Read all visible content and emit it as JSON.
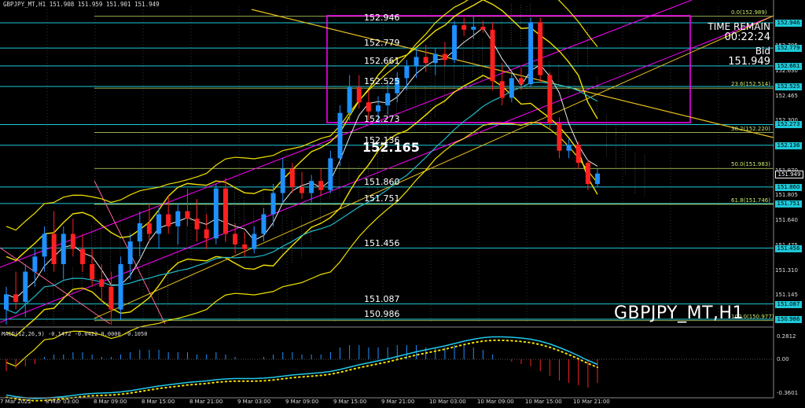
{
  "header": {
    "info": "GBPJPY_MT,H1  151.908 151.959 151.901 151.949",
    "macd_label": "MACD(12,26,9) -0.1472 -0.0422 0.0000 -0.1050"
  },
  "symbol_label": "GBPJPY_MT,H1",
  "timer": {
    "title": "TIME REMAIN",
    "value": "00:22:24",
    "bid_label": "Bid",
    "bid_value": "151.949"
  },
  "levels": [
    {
      "label": "152.946",
      "price": 152.946
    },
    {
      "label": "152.779",
      "price": 152.779
    },
    {
      "label": "152.661",
      "price": 152.661
    },
    {
      "label": "152.525",
      "price": 152.525
    },
    {
      "label": "152.273",
      "price": 152.273
    },
    {
      "label": "152.136",
      "price": 152.136
    },
    {
      "label": "151.860",
      "price": 151.86
    },
    {
      "label": "151.751",
      "price": 151.751
    },
    {
      "label": "151.456",
      "price": 151.456
    },
    {
      "label": "151.087",
      "price": 151.087
    },
    {
      "label": "150.986",
      "price": 150.986
    }
  ],
  "big_price": "152.165",
  "axis_ticks": [
    "152.795",
    "152.630",
    "152.465",
    "152.300",
    "151.970",
    "151.805",
    "151.640",
    "151.475",
    "151.310",
    "151.145"
  ],
  "right_tags": [
    {
      "label": "152.946",
      "price": 152.946,
      "kind": "level"
    },
    {
      "label": "152.779",
      "price": 152.779,
      "kind": "level"
    },
    {
      "label": "152.661",
      "price": 152.661,
      "kind": "level"
    },
    {
      "label": "152.525",
      "price": 152.525,
      "kind": "level"
    },
    {
      "label": "152.273",
      "price": 152.273,
      "kind": "level"
    },
    {
      "label": "152.136",
      "price": 152.136,
      "kind": "level"
    },
    {
      "label": "151.949",
      "price": 151.949,
      "kind": "current"
    },
    {
      "label": "151.860",
      "price": 151.86,
      "kind": "level"
    },
    {
      "label": "151.751",
      "price": 151.751,
      "kind": "level"
    },
    {
      "label": "151.456",
      "price": 151.456,
      "kind": "level"
    },
    {
      "label": "151.087",
      "price": 151.087,
      "kind": "level"
    },
    {
      "label": "150.986",
      "price": 150.986,
      "kind": "level"
    }
  ],
  "fib_labels": [
    {
      "label": "0.0(152.989)",
      "price": 152.989
    },
    {
      "label": "23.6(152.514)",
      "price": 152.514
    },
    {
      "label": "38.2(152.220)",
      "price": 152.22
    },
    {
      "label": "50.0(151.983)",
      "price": 151.983
    },
    {
      "label": "61.8(151.746)",
      "price": 151.746
    },
    {
      "label": "100.0(150.977)",
      "price": 150.977
    }
  ],
  "macd_axis": [
    "0.2812",
    "0.00",
    "-0.3601"
  ],
  "time_labels": [
    "7 Mar 2022",
    "8 Mar 03:00",
    "8 Mar 09:00",
    "8 Mar 15:00",
    "8 Mar 21:00",
    "9 Mar 03:00",
    "9 Mar 09:00",
    "9 Mar 15:00",
    "9 Mar 21:00",
    "10 Mar 03:00",
    "10 Mar 09:00",
    "10 Mar 15:00",
    "10 Mar 21:00"
  ],
  "colors": {
    "bull": "#1e90ff",
    "bear": "#ff2020",
    "level_line": "#1ec8d8",
    "channel": "#ff00ff",
    "bands": "#f0e000",
    "trend": "#e8c020",
    "ma_cyan": "#20b8c8",
    "ma_white": "#e8e8e8",
    "fib": "#c6e86b",
    "macd_signal": "#f0e000",
    "macd_line": "#20c8e8"
  },
  "candles": [
    [
      151.05,
      151.2,
      150.95,
      151.15
    ],
    [
      151.15,
      151.3,
      151.05,
      151.1
    ],
    [
      151.1,
      151.35,
      151.0,
      151.3
    ],
    [
      151.3,
      151.45,
      151.2,
      151.4
    ],
    [
      151.4,
      151.6,
      151.3,
      151.55
    ],
    [
      151.55,
      151.7,
      151.3,
      151.35
    ],
    [
      151.35,
      151.6,
      151.25,
      151.55
    ],
    [
      151.55,
      151.65,
      151.4,
      151.45
    ],
    [
      151.45,
      151.55,
      151.3,
      151.35
    ],
    [
      151.35,
      151.45,
      151.2,
      151.25
    ],
    [
      151.25,
      151.35,
      151.1,
      151.2
    ],
    [
      151.2,
      151.3,
      150.95,
      151.05
    ],
    [
      151.05,
      151.4,
      150.98,
      151.35
    ],
    [
      151.35,
      151.55,
      151.25,
      151.5
    ],
    [
      151.5,
      151.7,
      151.4,
      151.62
    ],
    [
      151.62,
      151.75,
      151.5,
      151.55
    ],
    [
      151.55,
      151.72,
      151.45,
      151.68
    ],
    [
      151.68,
      151.8,
      151.55,
      151.6
    ],
    [
      151.6,
      151.75,
      151.48,
      151.7
    ],
    [
      151.7,
      151.85,
      151.6,
      151.65
    ],
    [
      151.65,
      151.78,
      151.5,
      151.58
    ],
    [
      151.58,
      151.68,
      151.45,
      151.52
    ],
    [
      151.52,
      151.88,
      151.48,
      151.85
    ],
    [
      151.85,
      151.92,
      151.5,
      151.55
    ],
    [
      151.55,
      151.62,
      151.42,
      151.48
    ],
    [
      151.48,
      151.56,
      151.4,
      151.45
    ],
    [
      151.45,
      151.6,
      151.42,
      151.55
    ],
    [
      151.55,
      151.72,
      151.5,
      151.68
    ],
    [
      151.68,
      151.88,
      151.6,
      151.82
    ],
    [
      151.82,
      152.05,
      151.75,
      151.98
    ],
    [
      151.98,
      152.02,
      151.82,
      151.86
    ],
    [
      151.86,
      151.96,
      151.78,
      151.82
    ],
    [
      151.82,
      151.94,
      151.76,
      151.9
    ],
    [
      151.9,
      151.98,
      151.8,
      151.84
    ],
    [
      151.84,
      152.1,
      151.82,
      152.05
    ],
    [
      152.05,
      152.4,
      152.0,
      152.35
    ],
    [
      152.35,
      152.6,
      152.3,
      152.52
    ],
    [
      152.52,
      152.6,
      152.38,
      152.42
    ],
    [
      152.42,
      152.5,
      152.3,
      152.36
    ],
    [
      152.36,
      152.46,
      152.28,
      152.4
    ],
    [
      152.4,
      152.55,
      152.34,
      152.48
    ],
    [
      152.48,
      152.62,
      152.42,
      152.58
    ],
    [
      152.58,
      152.7,
      152.5,
      152.66
    ],
    [
      152.66,
      152.78,
      152.58,
      152.72
    ],
    [
      152.72,
      152.8,
      152.62,
      152.68
    ],
    [
      152.68,
      152.78,
      152.6,
      152.74
    ],
    [
      152.74,
      152.82,
      152.66,
      152.7
    ],
    [
      152.7,
      152.96,
      152.68,
      152.93
    ],
    [
      152.93,
      152.98,
      152.86,
      152.9
    ],
    [
      152.9,
      152.99,
      152.84,
      152.92
    ],
    [
      152.92,
      152.96,
      152.88,
      152.9
    ],
    [
      152.9,
      152.95,
      152.5,
      152.56
    ],
    [
      152.56,
      152.68,
      152.4,
      152.45
    ],
    [
      152.45,
      152.62,
      152.42,
      152.58
    ],
    [
      152.58,
      152.65,
      152.5,
      152.54
    ],
    [
      152.54,
      152.98,
      152.52,
      152.95
    ],
    [
      152.95,
      152.98,
      152.55,
      152.6
    ],
    [
      152.6,
      152.62,
      152.25,
      152.28
    ],
    [
      152.28,
      152.32,
      152.05,
      152.1
    ],
    [
      152.1,
      152.18,
      152.05,
      152.14
    ],
    [
      152.14,
      152.16,
      151.98,
      152.02
    ],
    [
      152.02,
      152.04,
      151.84,
      151.88
    ],
    [
      151.88,
      151.98,
      151.86,
      151.949
    ]
  ],
  "macd_hist": [
    -0.05,
    -0.04,
    -0.03,
    -0.02,
    0.01,
    0.02,
    0.02,
    0.03,
    0.03,
    0.02,
    0.01,
    0.01,
    0.02,
    0.03,
    0.04,
    0.04,
    0.04,
    0.03,
    0.03,
    0.03,
    0.02,
    0.02,
    0.03,
    0.02,
    0.01,
    0.0,
    0.0,
    0.01,
    0.02,
    0.03,
    0.03,
    0.02,
    0.02,
    0.02,
    0.03,
    0.05,
    0.06,
    0.06,
    0.05,
    0.05,
    0.05,
    0.06,
    0.06,
    0.06,
    0.05,
    0.05,
    0.05,
    0.06,
    0.06,
    0.05,
    0.04,
    0.02,
    0.0,
    -0.01,
    -0.02,
    -0.03,
    -0.05,
    -0.07,
    -0.09,
    -0.1,
    -0.11,
    -0.12,
    -0.1
  ]
}
